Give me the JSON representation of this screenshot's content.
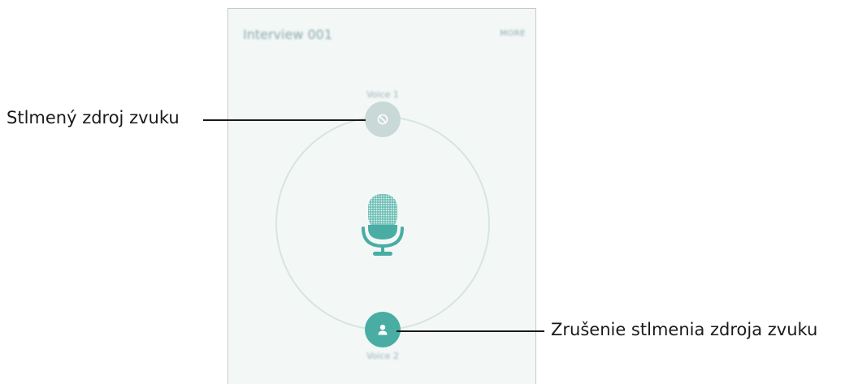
{
  "app": {
    "title": "Interview 001",
    "more_label": "MORE"
  },
  "speakers": {
    "voice1_label": "Voice 1",
    "voice2_label": "Voice 2",
    "voice1_state": "muted",
    "voice2_state": "unmuted"
  },
  "annotations": {
    "muted_source": "Stlmený zdroj zvuku",
    "unmute_source": "Zrušenie stlmenia zdroja zvuku"
  },
  "icons": {
    "voice1": "blocked-icon",
    "voice2": "person-icon",
    "center": "microphone-icon"
  },
  "colors": {
    "accent": "#49ada4",
    "muted": "#c9d9d8",
    "ring": "#d7e4e2",
    "background": "#f3f8f7"
  }
}
